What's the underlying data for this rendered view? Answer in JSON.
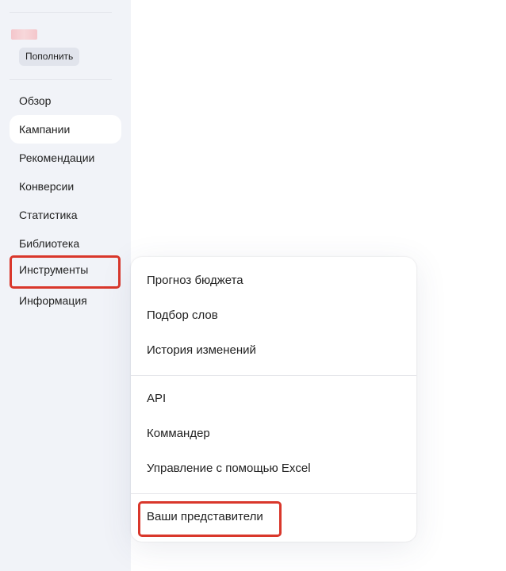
{
  "sidebar": {
    "topup_label": "Пополнить",
    "items": [
      {
        "label": "Обзор"
      },
      {
        "label": "Кампании"
      },
      {
        "label": "Рекомендации"
      },
      {
        "label": "Конверсии"
      },
      {
        "label": "Статистика"
      },
      {
        "label": "Библиотека"
      },
      {
        "label": "Инструменты"
      },
      {
        "label": "Информация"
      }
    ],
    "active_item": "Кампании"
  },
  "tools_menu": {
    "group1": [
      {
        "label": "Прогноз бюджета"
      },
      {
        "label": "Подбор слов"
      },
      {
        "label": "История изменений"
      }
    ],
    "group2": [
      {
        "label": "API"
      },
      {
        "label": "Коммандер"
      },
      {
        "label": "Управление с помощью Excel"
      }
    ],
    "group3": [
      {
        "label": "Ваши представители"
      }
    ]
  },
  "colors": {
    "highlight": "#d9372b",
    "sidebar_bg": "#f1f3f8"
  }
}
